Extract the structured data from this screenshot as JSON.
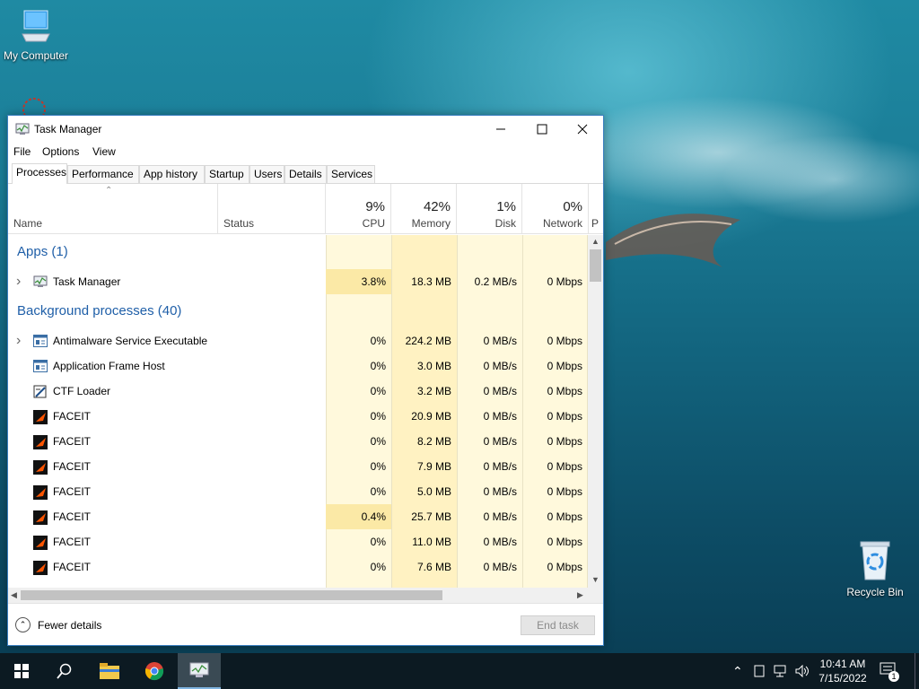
{
  "desktop": {
    "icons": [
      {
        "label": "My Computer"
      },
      {
        "label": "Recycle Bin"
      }
    ]
  },
  "window": {
    "title": "Task Manager",
    "menu": [
      "File",
      "Options",
      "View"
    ],
    "tabs": [
      "Processes",
      "Performance",
      "App history",
      "Startup",
      "Users",
      "Details",
      "Services"
    ],
    "active_tab": "Processes"
  },
  "columns": {
    "name": "Name",
    "status": "Status",
    "cpu": {
      "pct": "9%",
      "label": "CPU"
    },
    "memory": {
      "pct": "42%",
      "label": "Memory"
    },
    "disk": {
      "pct": "1%",
      "label": "Disk"
    },
    "network": {
      "pct": "0%",
      "label": "Network"
    },
    "power_partial": "P"
  },
  "groups": {
    "apps": "Apps (1)",
    "background": "Background processes (40)"
  },
  "apps": [
    {
      "name": "Task Manager",
      "cpu": "3.8%",
      "memory": "18.3 MB",
      "disk": "0.2 MB/s",
      "network": "0 Mbps"
    }
  ],
  "background": [
    {
      "name": "Antimalware Service Executable",
      "cpu": "0%",
      "memory": "224.2 MB",
      "disk": "0 MB/s",
      "network": "0 Mbps",
      "icon": "service-icon",
      "expand": true
    },
    {
      "name": "Application Frame Host",
      "cpu": "0%",
      "memory": "3.0 MB",
      "disk": "0 MB/s",
      "network": "0 Mbps",
      "icon": "service-icon",
      "expand": false
    },
    {
      "name": "CTF Loader",
      "cpu": "0%",
      "memory": "3.2 MB",
      "disk": "0 MB/s",
      "network": "0 Mbps",
      "icon": "ctf-icon",
      "expand": false
    },
    {
      "name": "FACEIT",
      "cpu": "0%",
      "memory": "20.9 MB",
      "disk": "0 MB/s",
      "network": "0 Mbps",
      "icon": "faceit-icon",
      "expand": false
    },
    {
      "name": "FACEIT",
      "cpu": "0%",
      "memory": "8.2 MB",
      "disk": "0 MB/s",
      "network": "0 Mbps",
      "icon": "faceit-icon",
      "expand": false
    },
    {
      "name": "FACEIT",
      "cpu": "0%",
      "memory": "7.9 MB",
      "disk": "0 MB/s",
      "network": "0 Mbps",
      "icon": "faceit-icon",
      "expand": false
    },
    {
      "name": "FACEIT",
      "cpu": "0%",
      "memory": "5.0 MB",
      "disk": "0 MB/s",
      "network": "0 Mbps",
      "icon": "faceit-icon",
      "expand": false
    },
    {
      "name": "FACEIT",
      "cpu": "0.4%",
      "memory": "25.7 MB",
      "disk": "0 MB/s",
      "network": "0 Mbps",
      "icon": "faceit-icon",
      "expand": false
    },
    {
      "name": "FACEIT",
      "cpu": "0%",
      "memory": "11.0 MB",
      "disk": "0 MB/s",
      "network": "0 Mbps",
      "icon": "faceit-icon",
      "expand": false
    },
    {
      "name": "FACEIT",
      "cpu": "0%",
      "memory": "7.6 MB",
      "disk": "0 MB/s",
      "network": "0 Mbps",
      "icon": "faceit-icon",
      "expand": false
    }
  ],
  "footer": {
    "fewer_details": "Fewer details",
    "end_task": "End task"
  },
  "taskbar": {
    "time": "10:41 AM",
    "date": "7/15/2022",
    "notification_count": "1"
  },
  "colors": {
    "heat_light": "#fff9dc",
    "heat_mid": "#fff2c2",
    "heat_cpu_row": "#fbe9a6",
    "accent": "#1f5fa8"
  }
}
